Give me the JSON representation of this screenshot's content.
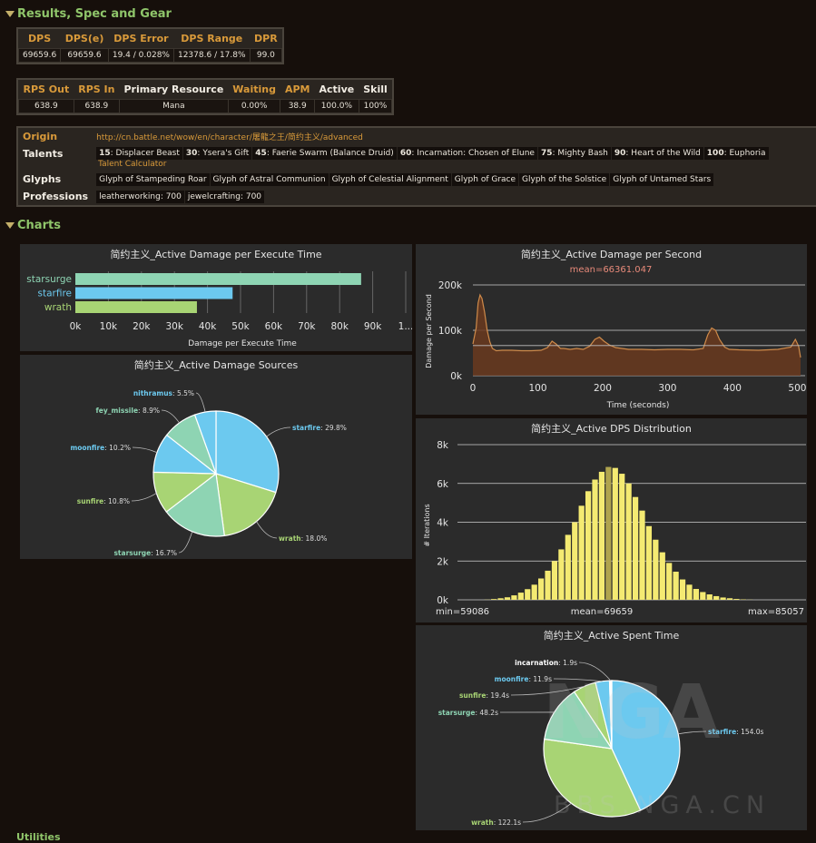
{
  "sections": {
    "results": "Results, Spec and Gear",
    "charts": "Charts",
    "utilities": "Utilities"
  },
  "dps_table": {
    "headers": [
      "DPS",
      "DPS(e)",
      "DPS Error",
      "DPS Range",
      "DPR"
    ],
    "values": [
      "69659.6",
      "69659.6",
      "19.4 / 0.028%",
      "12378.6 / 17.8%",
      "99.0"
    ]
  },
  "rps_table": {
    "headers": [
      "RPS Out",
      "RPS In",
      "Primary Resource",
      "Waiting",
      "APM",
      "Active",
      "Skill"
    ],
    "values": [
      "638.9",
      "638.9",
      "Mana",
      "0.00%",
      "38.9",
      "100.0%",
      "100%"
    ]
  },
  "info": {
    "origin_label": "Origin",
    "origin_value": "http://cn.battle.net/wow/en/character/屠龍之王/简约主义/advanced",
    "talents_label": "Talents",
    "talents": [
      {
        "lvl": "15",
        "name": "Displacer Beast"
      },
      {
        "lvl": "30",
        "name": "Ysera's Gift"
      },
      {
        "lvl": "45",
        "name": "Faerie Swarm (Balance Druid)"
      },
      {
        "lvl": "60",
        "name": "Incarnation: Chosen of Elune"
      },
      {
        "lvl": "75",
        "name": "Mighty Bash"
      },
      {
        "lvl": "90",
        "name": "Heart of the Wild"
      },
      {
        "lvl": "100",
        "name": "Euphoria"
      }
    ],
    "talent_calc": "Talent Calculator",
    "glyphs_label": "Glyphs",
    "glyphs": [
      "Glyph of Stampeding Roar",
      "Glyph of Astral Communion",
      "Glyph of Celestial Alignment",
      "Glyph of Grace",
      "Glyph of the Solstice",
      "Glyph of Untamed Stars"
    ],
    "professions_label": "Professions",
    "professions": [
      "leatherworking: 700",
      "jewelcrafting: 700"
    ]
  },
  "colors": {
    "starsurge": "#8ed4b3",
    "starfire": "#6cc9ef",
    "wrath": "#a8d474",
    "moonfire": "#6cc9ef",
    "sunfire": "#a8d474",
    "fey_missile": "#8ed4b3",
    "nithramus": "#6cc9ef",
    "incarnation": "#ffffff",
    "dps_line": "#ce8a4a",
    "hist": "#f4ea72"
  },
  "chart_data": [
    {
      "type": "bar",
      "title": "简约主义_Active Damage per Execute Time",
      "xlabel": "Damage per Execute Time",
      "categories": [
        "starsurge",
        "starfire",
        "wrath"
      ],
      "values": [
        86500,
        47600,
        36800
      ],
      "xlim": [
        0,
        100000
      ],
      "tick_labels": [
        "0k",
        "10k",
        "20k",
        "30k",
        "40k",
        "50k",
        "60k",
        "70k",
        "80k",
        "90k",
        "1..."
      ]
    },
    {
      "type": "pie",
      "title": "简约主义_Active Damage Sources",
      "slices": [
        {
          "name": "starfire",
          "label": "starfire",
          "value_label": "29.8%",
          "value": 29.8
        },
        {
          "name": "wrath",
          "label": "wrath",
          "value_label": "18.0%",
          "value": 18.0
        },
        {
          "name": "starsurge",
          "label": "starsurge",
          "value_label": "16.7%",
          "value": 16.7
        },
        {
          "name": "sunfire",
          "label": "sunfire",
          "value_label": "10.8%",
          "value": 10.8
        },
        {
          "name": "moonfire",
          "label": "moonfire",
          "value_label": "10.2%",
          "value": 10.2
        },
        {
          "name": "fey_missile",
          "label": "fey_missile",
          "value_label": "8.9%",
          "value": 8.9
        },
        {
          "name": "nithramus",
          "label": "nithramus",
          "value_label": "5.5%",
          "value": 5.5
        }
      ]
    },
    {
      "type": "area",
      "title": "简约主义_Active Damage per Second",
      "subtitle": "mean=66361.047",
      "xlabel": "Time (seconds)",
      "ylabel": "Damage per Second",
      "xlim": [
        0,
        505
      ],
      "ylim": [
        0,
        200000
      ],
      "xticks": [
        0,
        100,
        200,
        300,
        400,
        500
      ],
      "yticks": [
        {
          "v": 0,
          "l": "0k"
        },
        {
          "v": 100000,
          "l": "100k"
        },
        {
          "v": 200000,
          "l": "200k"
        }
      ],
      "mean": 66361.047,
      "x": [
        0,
        5,
        8,
        11,
        14,
        18,
        22,
        26,
        30,
        36,
        45,
        60,
        75,
        90,
        105,
        115,
        122,
        128,
        135,
        140,
        150,
        160,
        170,
        180,
        188,
        195,
        202,
        210,
        220,
        240,
        260,
        280,
        300,
        320,
        340,
        355,
        362,
        368,
        374,
        380,
        388,
        395,
        410,
        440,
        470,
        490,
        497,
        502,
        505
      ],
      "y": [
        70000,
        105000,
        160000,
        178000,
        170000,
        140000,
        100000,
        75000,
        60000,
        55000,
        56000,
        56000,
        55000,
        55000,
        56000,
        62000,
        76000,
        70000,
        60000,
        60000,
        58000,
        60000,
        58000,
        65000,
        80000,
        85000,
        76000,
        68000,
        62000,
        58000,
        58000,
        57000,
        58000,
        58000,
        57000,
        60000,
        90000,
        105000,
        100000,
        80000,
        63000,
        58000,
        57000,
        56000,
        58000,
        63000,
        80000,
        65000,
        40000
      ]
    },
    {
      "type": "bar",
      "title": "简约主义_Active DPS Distribution",
      "ylabel": "# Iterations",
      "ylim": [
        0,
        8000
      ],
      "yticks": [
        {
          "v": 0,
          "l": "0k"
        },
        {
          "v": 2000,
          "l": "2k"
        },
        {
          "v": 4000,
          "l": "4k"
        },
        {
          "v": 6000,
          "l": "6k"
        },
        {
          "v": 8000,
          "l": "8k"
        }
      ],
      "min_label": "min=59086",
      "mean_label": "mean=69659",
      "max_label": "max=85057",
      "values": [
        10,
        40,
        80,
        130,
        230,
        370,
        550,
        780,
        1100,
        1500,
        2000,
        2600,
        3350,
        4000,
        4850,
        5600,
        6200,
        6600,
        6850,
        6800,
        6500,
        6000,
        5300,
        4600,
        3800,
        3100,
        2450,
        1900,
        1450,
        1050,
        780,
        560,
        400,
        280,
        190,
        120,
        80,
        45,
        20,
        8
      ]
    },
    {
      "type": "pie",
      "title": "简约主义_Active Spent Time",
      "slices": [
        {
          "name": "starfire",
          "label": "starfire",
          "value_label": "154.0s",
          "value": 154.0
        },
        {
          "name": "wrath",
          "label": "wrath",
          "value_label": "122.1s",
          "value": 122.1
        },
        {
          "name": "starsurge",
          "label": "starsurge",
          "value_label": "48.2s",
          "value": 48.2
        },
        {
          "name": "sunfire",
          "label": "sunfire",
          "value_label": "19.4s",
          "value": 19.4
        },
        {
          "name": "moonfire",
          "label": "moonfire",
          "value_label": "11.9s",
          "value": 11.9
        },
        {
          "name": "incarnation",
          "label": "incarnation",
          "value_label": "1.9s",
          "value": 1.9
        }
      ]
    }
  ]
}
